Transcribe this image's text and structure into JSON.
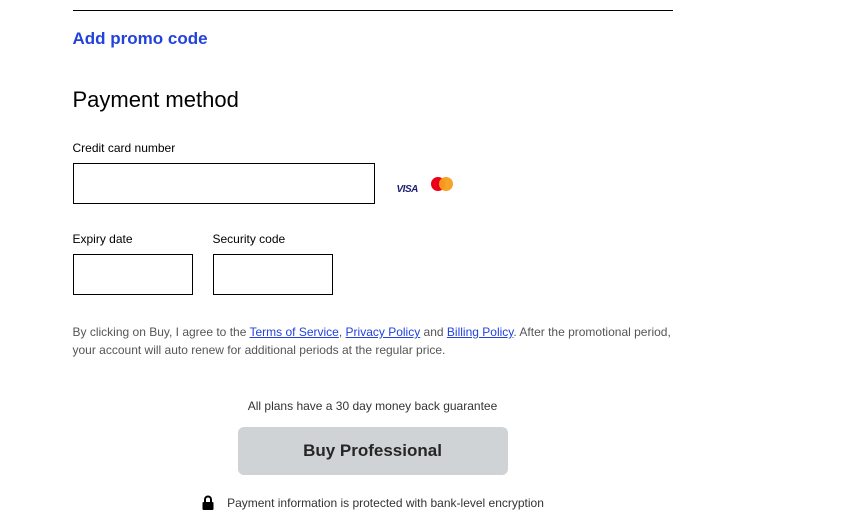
{
  "promo": {
    "label": "Add promo code"
  },
  "payment": {
    "section_title": "Payment method",
    "cc_label": "Credit card number",
    "expiry_label": "Expiry date",
    "cvv_label": "Security code"
  },
  "legal": {
    "prefix": "By clicking on Buy, I agree to the ",
    "tos": "Terms of Service",
    "sep1": ", ",
    "privacy": "Privacy Policy",
    "sep2": " and ",
    "billing": "Billing Policy",
    "suffix": ". After the promotional period, your account will auto renew for additional periods at the regular price."
  },
  "guarantee": "All plans have a 30 day money back guarantee",
  "buy_button": "Buy Professional",
  "security_note": "Payment information is protected with bank-level encryption"
}
